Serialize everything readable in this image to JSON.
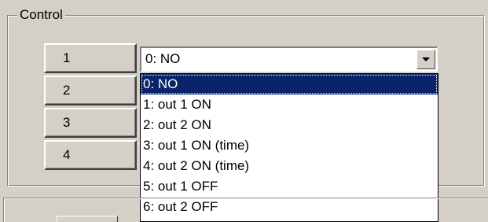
{
  "group": {
    "label": "Control"
  },
  "rows": [
    {
      "number": "1"
    },
    {
      "number": "2"
    },
    {
      "number": "3"
    },
    {
      "number": "4"
    }
  ],
  "combo": {
    "selected_value": "0: NO",
    "arrow_icon": "chevron-down-icon"
  },
  "dropdown": {
    "options": [
      "0: NO",
      "1: out 1 ON",
      "2: out 2 ON",
      "3: out 1 ON (time)",
      "4: out 2 ON (time)",
      "5: out 1 OFF",
      "6: out 2 OFF"
    ],
    "selected_index": 0
  },
  "colors": {
    "face": "#d4d0c8",
    "highlight": "#0a246a",
    "window": "#ffffff"
  }
}
